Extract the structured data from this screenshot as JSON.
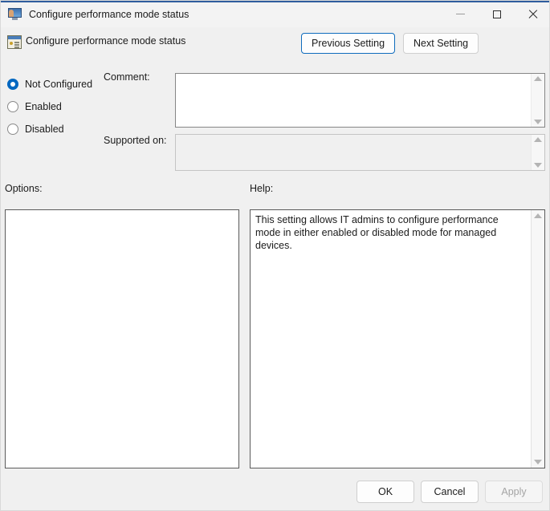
{
  "window": {
    "title": "Configure performance mode status",
    "icon": "computer-user-icon",
    "controls": {
      "minimize": "minimize-icon",
      "maximize": "maximize-icon",
      "close": "close-icon"
    }
  },
  "header": {
    "icon": "policy-setting-icon",
    "title": "Configure performance mode status",
    "previous_setting_label": "Previous Setting",
    "next_setting_label": "Next Setting"
  },
  "state_options": [
    {
      "label": "Not Configured",
      "selected": true
    },
    {
      "label": "Enabled",
      "selected": false
    },
    {
      "label": "Disabled",
      "selected": false
    }
  ],
  "fields": {
    "comment_label": "Comment:",
    "comment_value": "",
    "supported_on_label": "Supported on:",
    "supported_on_value": ""
  },
  "panels": {
    "options_label": "Options:",
    "options_value": "",
    "help_label": "Help:",
    "help_text": "This setting allows IT admins to configure performance mode in either enabled or disabled mode for managed devices."
  },
  "footer": {
    "ok_label": "OK",
    "cancel_label": "Cancel",
    "apply_label": "Apply",
    "apply_enabled": false
  },
  "colors": {
    "accent": "#0067c0",
    "focus_border": "#0f6cbd",
    "title_accent": "#2f5d9e",
    "window_background": "#f0f0f0",
    "panel_border": "#5b5b5b"
  }
}
